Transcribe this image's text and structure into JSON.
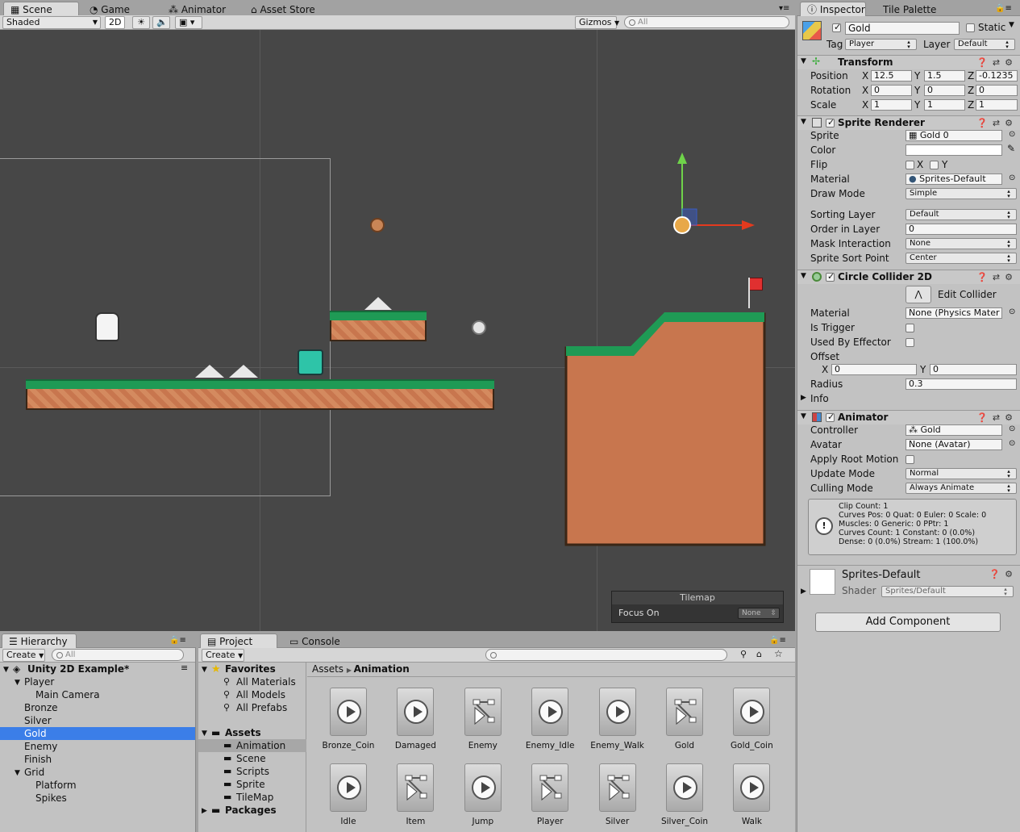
{
  "scene_tabs": {
    "scene": "Scene",
    "game": "Game",
    "animator": "Animator",
    "asset_store": "Asset Store"
  },
  "scene_toolbar": {
    "shading": "Shaded",
    "mode_2d": "2D",
    "gizmos": "Gizmos",
    "search_placeholder": "All"
  },
  "inspector_tabs": {
    "inspector": "Inspector",
    "tile_palette": "Tile Palette"
  },
  "object": {
    "name": "Gold",
    "static_label": "Static",
    "tag_label": "Tag",
    "tag": "Player",
    "layer_label": "Layer",
    "layer": "Default"
  },
  "transform": {
    "title": "Transform",
    "position_label": "Position",
    "rotation_label": "Rotation",
    "scale_label": "Scale",
    "position": {
      "x": "12.5",
      "y": "1.5",
      "z": "-0.1235"
    },
    "rotation": {
      "x": "0",
      "y": "0",
      "z": "0"
    },
    "scale": {
      "x": "1",
      "y": "1",
      "z": "1"
    }
  },
  "sprite_renderer": {
    "title": "Sprite Renderer",
    "sprite_label": "Sprite",
    "sprite": "Gold 0",
    "color_label": "Color",
    "flip_label": "Flip",
    "flip_x": "X",
    "flip_y": "Y",
    "material_label": "Material",
    "material": "Sprites-Default",
    "draw_mode_label": "Draw Mode",
    "draw_mode": "Simple",
    "sorting_layer_label": "Sorting Layer",
    "sorting_layer": "Default",
    "order_label": "Order in Layer",
    "order": "0",
    "mask_label": "Mask Interaction",
    "mask": "None",
    "sort_point_label": "Sprite Sort Point",
    "sort_point": "Center"
  },
  "circle_collider": {
    "title": "Circle Collider 2D",
    "edit_collider": "Edit Collider",
    "material_label": "Material",
    "material": "None (Physics Mater",
    "is_trigger_label": "Is Trigger",
    "effector_label": "Used By Effector",
    "offset_label": "Offset",
    "offset_x": "0",
    "offset_y": "0",
    "radius_label": "Radius",
    "radius": "0.3",
    "info_label": "Info"
  },
  "animator": {
    "title": "Animator",
    "controller_label": "Controller",
    "controller": "Gold",
    "avatar_label": "Avatar",
    "avatar": "None (Avatar)",
    "root_motion_label": "Apply Root Motion",
    "update_mode_label": "Update Mode",
    "update_mode": "Normal",
    "culling_label": "Culling Mode",
    "culling": "Always Animate",
    "info": [
      "Clip Count: 1",
      "Curves Pos: 0 Quat: 0 Euler: 0 Scale: 0",
      "Muscles: 0 Generic: 0 PPtr: 1",
      "Curves Count: 1 Constant: 0 (0.0%)",
      "Dense: 0 (0.0%) Stream: 1 (100.0%)"
    ]
  },
  "material_preview": {
    "name": "Sprites-Default",
    "shader_label": "Shader",
    "shader": "Sprites/Default"
  },
  "add_component": "Add Component",
  "tilemap_overlay": {
    "title": "Tilemap",
    "focus_label": "Focus On",
    "focus_value": "None"
  },
  "hierarchy": {
    "tab": "Hierarchy",
    "create": "Create",
    "search_placeholder": "All",
    "scene_name": "Unity 2D Example*",
    "items": [
      {
        "label": "Player"
      },
      {
        "label": "Main Camera"
      },
      {
        "label": "Bronze"
      },
      {
        "label": "Silver"
      },
      {
        "label": "Gold"
      },
      {
        "label": "Enemy"
      },
      {
        "label": "Finish"
      },
      {
        "label": "Grid"
      },
      {
        "label": "Platform"
      },
      {
        "label": "Spikes"
      }
    ]
  },
  "project": {
    "tab": "Project",
    "console_tab": "Console",
    "create": "Create",
    "favorites_label": "Favorites",
    "favorites": [
      "All Materials",
      "All Models",
      "All Prefabs"
    ],
    "assets_label": "Assets",
    "folders": [
      "Animation",
      "Scene",
      "Scripts",
      "Sprite",
      "TileMap"
    ],
    "packages_label": "Packages",
    "breadcrumb": {
      "root": "Assets",
      "current": "Animation"
    },
    "files": [
      {
        "name": "Bronze_Coin",
        "kind": "clip"
      },
      {
        "name": "Damaged",
        "kind": "clip"
      },
      {
        "name": "Enemy",
        "kind": "controller"
      },
      {
        "name": "Enemy_Idle",
        "kind": "clip"
      },
      {
        "name": "Enemy_Walk",
        "kind": "clip"
      },
      {
        "name": "Gold",
        "kind": "controller"
      },
      {
        "name": "Gold_Coin",
        "kind": "clip"
      },
      {
        "name": "Idle",
        "kind": "clip"
      },
      {
        "name": "Item",
        "kind": "controller"
      },
      {
        "name": "Jump",
        "kind": "clip"
      },
      {
        "name": "Player",
        "kind": "controller"
      },
      {
        "name": "Silver",
        "kind": "controller"
      },
      {
        "name": "Silver_Coin",
        "kind": "clip"
      },
      {
        "name": "Walk",
        "kind": "clip"
      }
    ]
  },
  "colors": {
    "selection": "#3b7ee8",
    "grass": "#1f9a55",
    "dirt": "#c8764e",
    "scene_bg": "#474747",
    "panel_bg": "#c2c2c2"
  }
}
